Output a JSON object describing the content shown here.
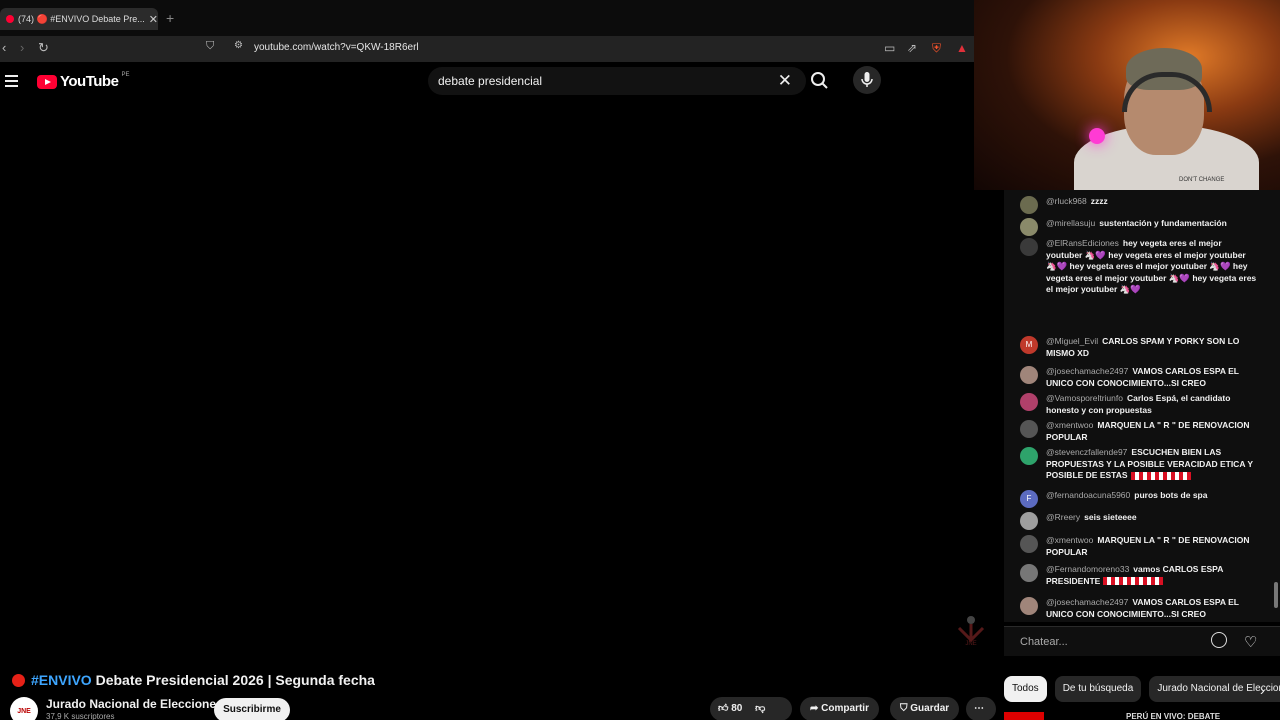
{
  "browser": {
    "tab_title": "(74) 🔴 #ENVIVO Debate Pre...",
    "url": "youtube.com/watch?v=QKW-18R6erl"
  },
  "masthead": {
    "logo_text": "YouTube",
    "country_code": "PE",
    "search_query": "debate presidencial"
  },
  "video": {
    "title_hashtag": "#ENVIVO",
    "title_rest": " Debate Presidencial 2026 | Segunda fecha",
    "channel_name": "Jurado Nacional de Elecciones",
    "subscribers": "37,9 K suscriptores",
    "subscribe_label": "Suscribirme",
    "likes": "80",
    "share_label": "Compartir",
    "save_label": "Guardar",
    "watermark": "JNE"
  },
  "webcam": {
    "shirt_text": "DON'T CHANGE"
  },
  "chat": {
    "messages": [
      {
        "author": "@rluck968",
        "text": "zzzz",
        "avatar_color": "#6b6b4f"
      },
      {
        "author": "@mirellasuju",
        "text": "sustentación y fundamentación",
        "avatar_color": "#8a8a6a"
      },
      {
        "author": "@ElRansEdiciones",
        "text": "hey vegeta eres el mejor youtuber 🦄💜 hey vegeta eres el mejor youtuber 🦄💜 hey vegeta eres el mejor youtuber 🦄💜 hey vegeta eres el mejor youtuber 🦄💜 hey vegeta eres el mejor youtuber 🦄💜",
        "avatar_color": "#3a3a3a"
      },
      {
        "author": "@Miguel_Evil",
        "text": "CARLOS SPAM Y PORKY SON LO MISMO XD",
        "avatar_color": "#c0392b",
        "initial": "M"
      },
      {
        "author": "@josechamache2497",
        "text": "VAMOS CARLOS ESPA EL UNICO CON CONOCIMIENTO...SI CREO",
        "avatar_color": "#a0857a"
      },
      {
        "author": "@Vamosporeltriunfo",
        "text": "Carlos Espá, el candidato honesto y con propuestas",
        "avatar_color": "#b0406a"
      },
      {
        "author": "@xmentwoo",
        "text": "MARQUEN LA \" R \" DE RENOVACION POPULAR",
        "avatar_color": "#555"
      },
      {
        "author": "@stevenczfallende97",
        "text": "ESCUCHEN BIEN LAS PROPUESTAS Y LA POSIBLE VERACIDAD ETICA Y POSIBLE DE ESTAS",
        "avatar_color": "#2ea36b",
        "flags": true
      },
      {
        "author": "@fernandoacuna5960",
        "text": "puros bots de spa",
        "avatar_color": "#5c6bc0",
        "initial": "F"
      },
      {
        "author": "@Rreery",
        "text": "seis sieteeee",
        "avatar_color": "#9e9e9e"
      },
      {
        "author": "@xmentwoo",
        "text": "MARQUEN LA \" R \" DE RENOVACION POPULAR",
        "avatar_color": "#555"
      },
      {
        "author": "@Fernandomoreno33",
        "text": "vamos CARLOS ESPA PRESIDENTE",
        "avatar_color": "#777",
        "flags": true
      },
      {
        "author": "@josechamache2497",
        "text": "VAMOS CARLOS ESPA EL UNICO CON CONOCIMIENTO...SI CREO",
        "avatar_color": "#a0857a"
      }
    ],
    "input_placeholder": "Chatear...",
    "chips": [
      "Todos",
      "De tu búsqueda",
      "Jurado Nacional de Elecciones"
    ],
    "ticker_text": "PERÚ EN VIVO: DEBATE"
  }
}
